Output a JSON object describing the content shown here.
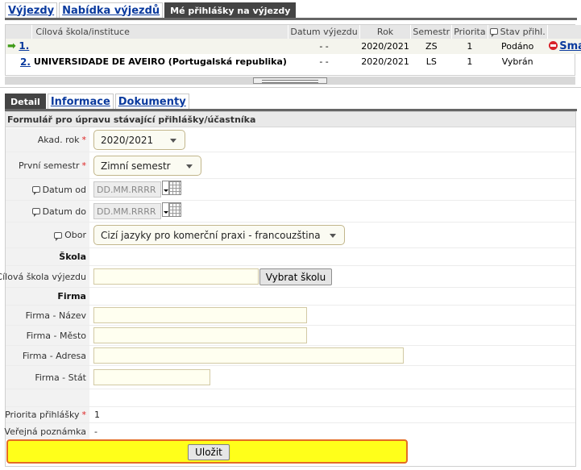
{
  "top_tabs": [
    {
      "label": "Výjezdy"
    },
    {
      "label": "Nabídka výjezdů"
    },
    {
      "label": "Mé přihlášky na výjezdy"
    }
  ],
  "applications": {
    "columns": [
      "Cílová škola/instituce",
      "Datum výjezdu",
      "Rok",
      "Semestr",
      "Priorita",
      "Stav přihl."
    ],
    "rows": [
      {
        "num": "1.",
        "school": "",
        "date": "- -",
        "year": "2020/2021",
        "semester": "ZS",
        "priority": "1",
        "status": "Podáno",
        "action": "Smazat"
      },
      {
        "num": "2.",
        "school": "UNIVERSIDADE DE AVEIRO (Portugalská republika)",
        "date": "- -",
        "year": "2020/2021",
        "semester": "LS",
        "priority": "1",
        "status": "Vybrán",
        "action": ""
      }
    ]
  },
  "detail_tabs": [
    {
      "label": "Detail"
    },
    {
      "label": "Informace"
    },
    {
      "label": "Dokumenty"
    }
  ],
  "form": {
    "title": "Formulář pro úpravu stávající přihlášky/účastníka",
    "akad_rok": {
      "label": "Akad. rok",
      "value": "2020/2021"
    },
    "prvni_semestr": {
      "label": "První semestr",
      "value": "Zimní semestr"
    },
    "datum_od": {
      "label": "Datum od",
      "placeholder": "DD.MM.RRRR"
    },
    "datum_do": {
      "label": "Datum do",
      "placeholder": "DD.MM.RRRR"
    },
    "obor": {
      "label": "Obor",
      "value": "Cizí jazyky pro komerční praxi - francouzština"
    },
    "skola_heading": "Škola",
    "cilova_skola": {
      "label": "Cílová škola výjezdu",
      "value": "",
      "button": "Vybrat školu"
    },
    "firma_heading": "Firma",
    "firma_nazev": {
      "label": "Firma - Název",
      "value": ""
    },
    "firma_mesto": {
      "label": "Firma - Město",
      "value": ""
    },
    "firma_adresa": {
      "label": "Firma - Adresa",
      "value": ""
    },
    "firma_stat": {
      "label": "Firma - Stát",
      "value": ""
    },
    "priorita": {
      "label": "Priorita přihlášky",
      "value": "1"
    },
    "poznamka": {
      "label": "Veřejná poznámka",
      "value": "-"
    },
    "save_label": "Uložit"
  },
  "colors": {
    "link": "#0a3a9e",
    "required": "#d22222",
    "save_bar": "#ffff1a",
    "save_border": "#e46d24"
  }
}
